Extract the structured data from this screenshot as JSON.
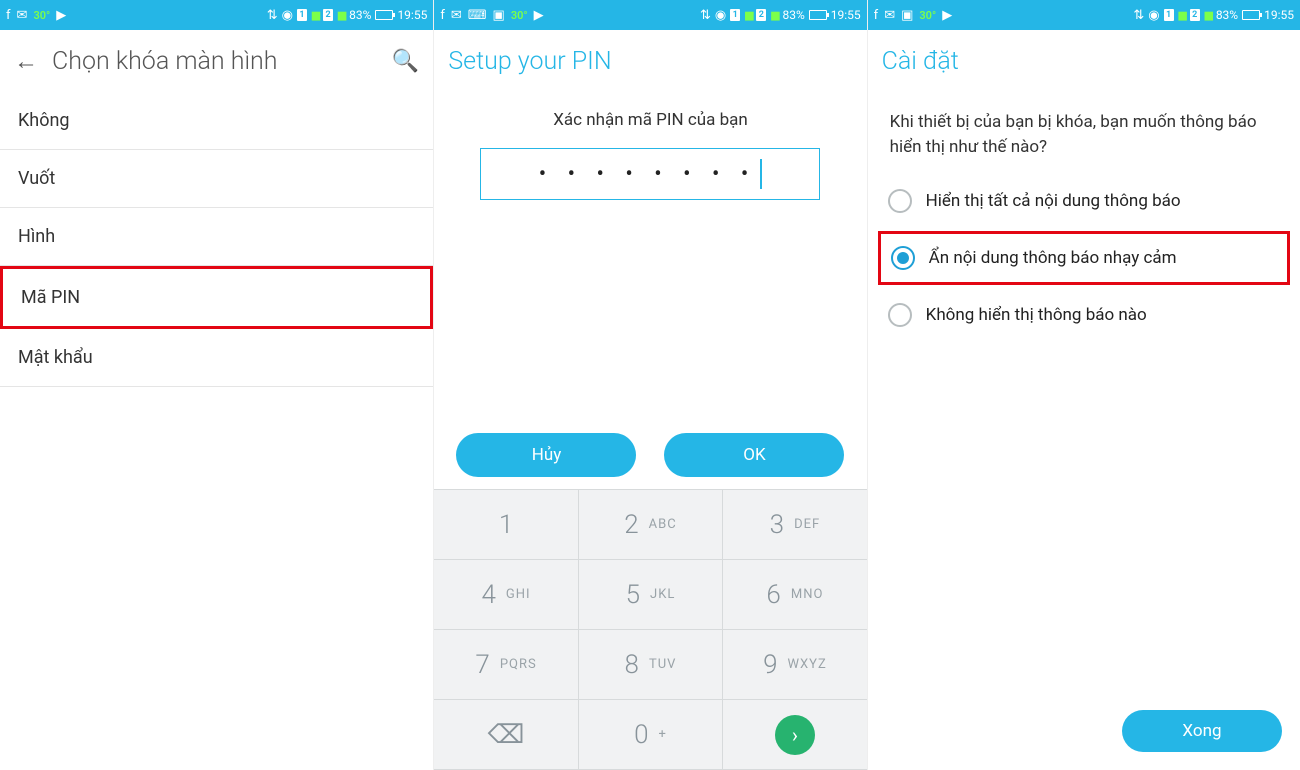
{
  "status_bar": {
    "temp": "30°",
    "battery_percent": "83%",
    "time": "19:55"
  },
  "panel1": {
    "title": "Chọn khóa màn hình",
    "items": [
      {
        "label": "Không",
        "highlighted": false
      },
      {
        "label": "Vuốt",
        "highlighted": false
      },
      {
        "label": "Hình",
        "highlighted": false
      },
      {
        "label": "Mã PIN",
        "highlighted": true
      },
      {
        "label": "Mật khẩu",
        "highlighted": false
      }
    ]
  },
  "panel2": {
    "title": "Setup your PIN",
    "prompt": "Xác nhận mã PIN của bạn",
    "pin_dots": "• • • • • • • •",
    "cancel": "Hủy",
    "ok": "OK",
    "keypad": [
      [
        {
          "n": "1",
          "s": ""
        },
        {
          "n": "2",
          "s": "ABC"
        },
        {
          "n": "3",
          "s": "DEF"
        }
      ],
      [
        {
          "n": "4",
          "s": "GHI"
        },
        {
          "n": "5",
          "s": "JKL"
        },
        {
          "n": "6",
          "s": "MNO"
        }
      ],
      [
        {
          "n": "7",
          "s": "PQRS"
        },
        {
          "n": "8",
          "s": "TUV"
        },
        {
          "n": "9",
          "s": "WXYZ"
        }
      ],
      [
        {
          "n": "⌫",
          "s": ""
        },
        {
          "n": "0",
          "s": "+"
        },
        {
          "n": "›",
          "s": "",
          "go": true
        }
      ]
    ]
  },
  "panel3": {
    "title": "Cài đặt",
    "question": "Khi thiết bị của bạn bị khóa, bạn muốn thông báo hiển thị như thế nào?",
    "options": [
      {
        "label": "Hiển thị tất cả nội dung thông báo",
        "selected": false,
        "boxed": false
      },
      {
        "label": "Ẩn nội dung thông báo nhạy cảm",
        "selected": true,
        "boxed": true
      },
      {
        "label": "Không hiển thị thông báo nào",
        "selected": false,
        "boxed": false
      }
    ],
    "done": "Xong"
  }
}
